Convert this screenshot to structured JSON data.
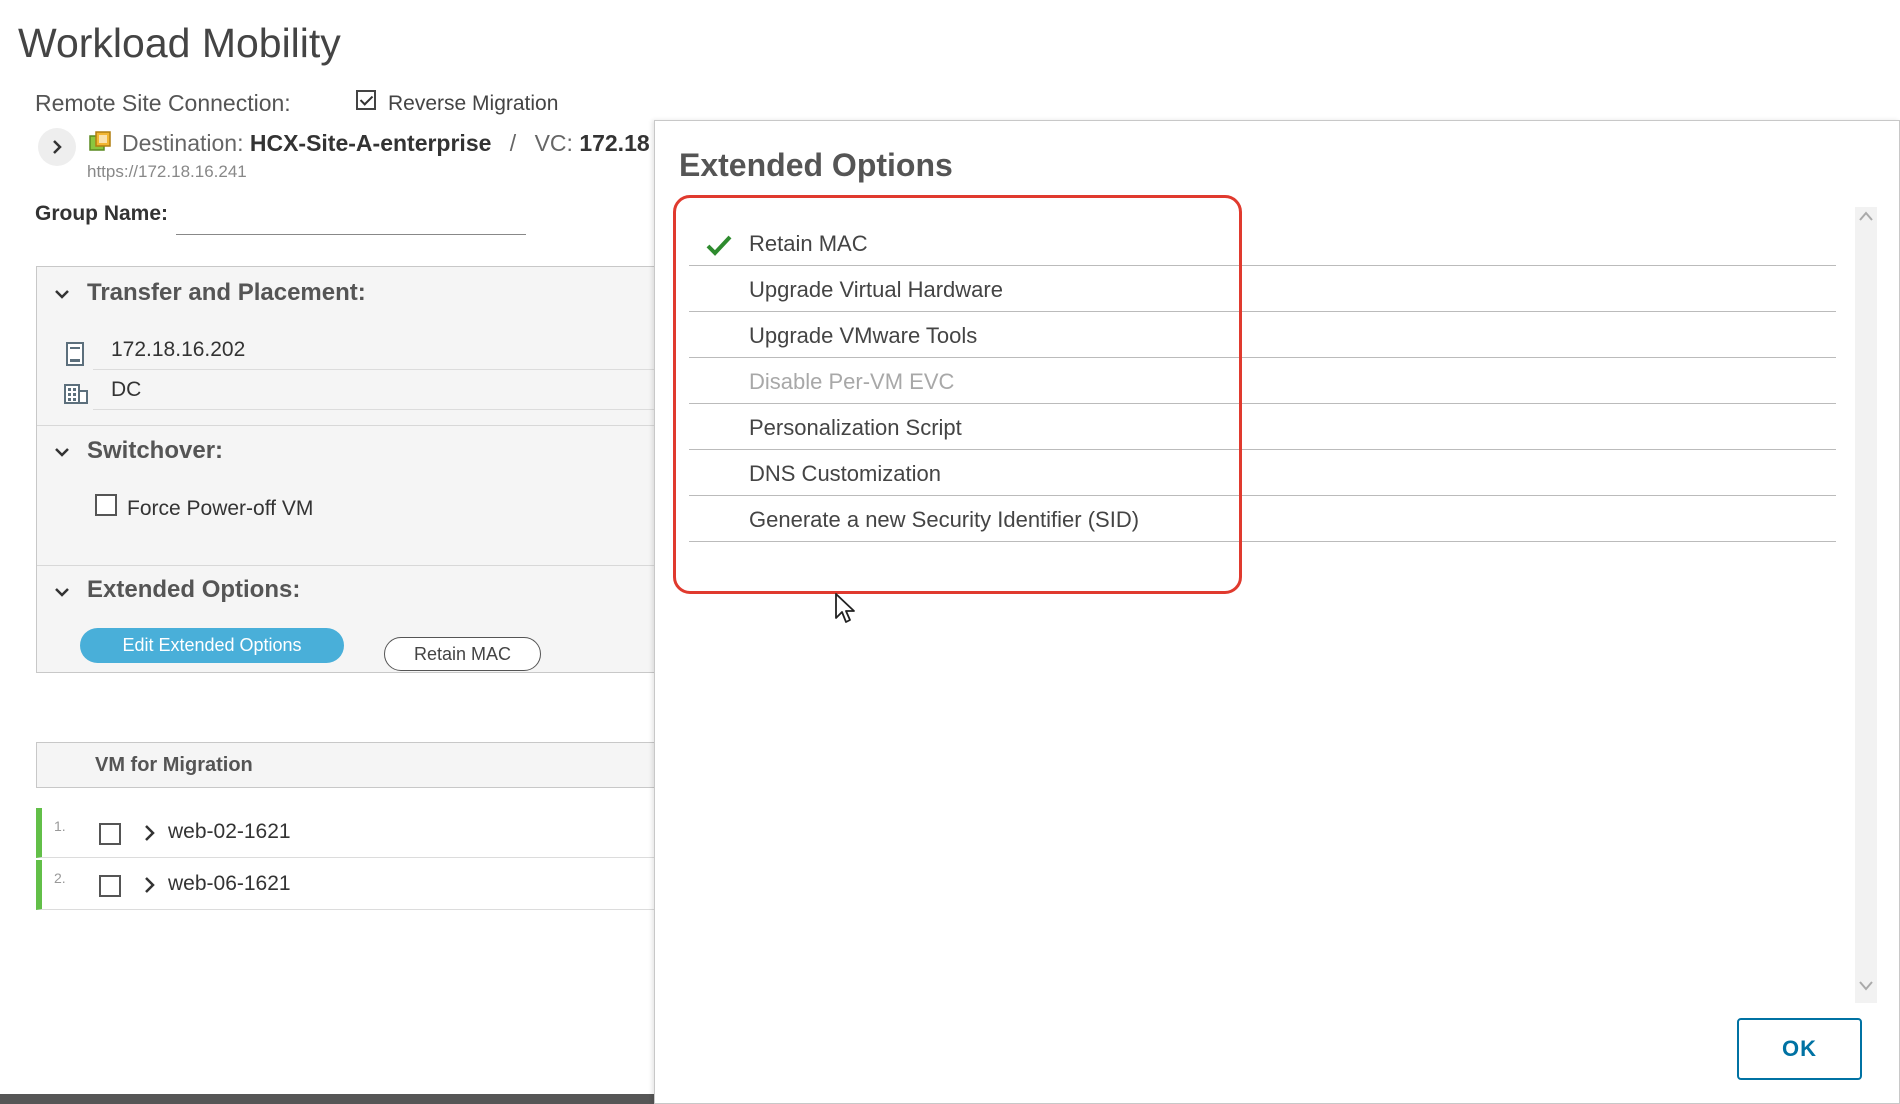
{
  "page": {
    "title": "Workload Mobility"
  },
  "connection": {
    "label": "Remote Site Connection:",
    "reverse_migration_label": "Reverse Migration",
    "reverse_migration_checked": true,
    "destination_label": "Destination:",
    "destination_value": "HCX-Site-A-enterprise",
    "separator": "/",
    "vc_label": "VC:",
    "vc_value": "172.18",
    "url": "https://172.18.16.241"
  },
  "group": {
    "label": "Group Name:",
    "value": ""
  },
  "transfer": {
    "title": "Transfer and Placement:",
    "host": "172.18.16.202",
    "datacenter": "DC"
  },
  "switchover": {
    "title": "Switchover:",
    "force_poweroff_label": "Force Power-off VM"
  },
  "extended": {
    "title": "Extended Options:",
    "edit_button": "Edit Extended Options",
    "selected_pill": "Retain MAC"
  },
  "vm_list": {
    "header": "VM for Migration",
    "rows": [
      {
        "num": "1.",
        "name": "web-02-1621"
      },
      {
        "num": "2.",
        "name": "web-06-1621"
      }
    ]
  },
  "modal": {
    "title": "Extended Options",
    "options": [
      {
        "label": "Retain MAC",
        "checked": true,
        "disabled": false
      },
      {
        "label": "Upgrade Virtual Hardware",
        "checked": false,
        "disabled": false
      },
      {
        "label": "Upgrade VMware Tools",
        "checked": false,
        "disabled": false
      },
      {
        "label": "Disable Per-VM EVC",
        "checked": false,
        "disabled": true
      },
      {
        "label": "Personalization Script",
        "checked": false,
        "disabled": false
      },
      {
        "label": "DNS Customization",
        "checked": false,
        "disabled": false
      },
      {
        "label": "Generate a new Security Identifier (SID)",
        "checked": false,
        "disabled": false
      }
    ],
    "ok_label": "OK"
  },
  "colors": {
    "accent_blue": "#49afd9",
    "ok_blue": "#0072a3",
    "highlight_red": "#e03a2e",
    "check_green": "#2e8b2e",
    "row_marker_green": "#62bf48"
  },
  "icons": [
    "chevron-right-icon",
    "site-icon",
    "host-icon",
    "datacenter-icon",
    "chevron-down-icon",
    "checkmark-icon",
    "scroll-up-icon",
    "scroll-down-icon",
    "mouse-cursor-icon"
  ]
}
